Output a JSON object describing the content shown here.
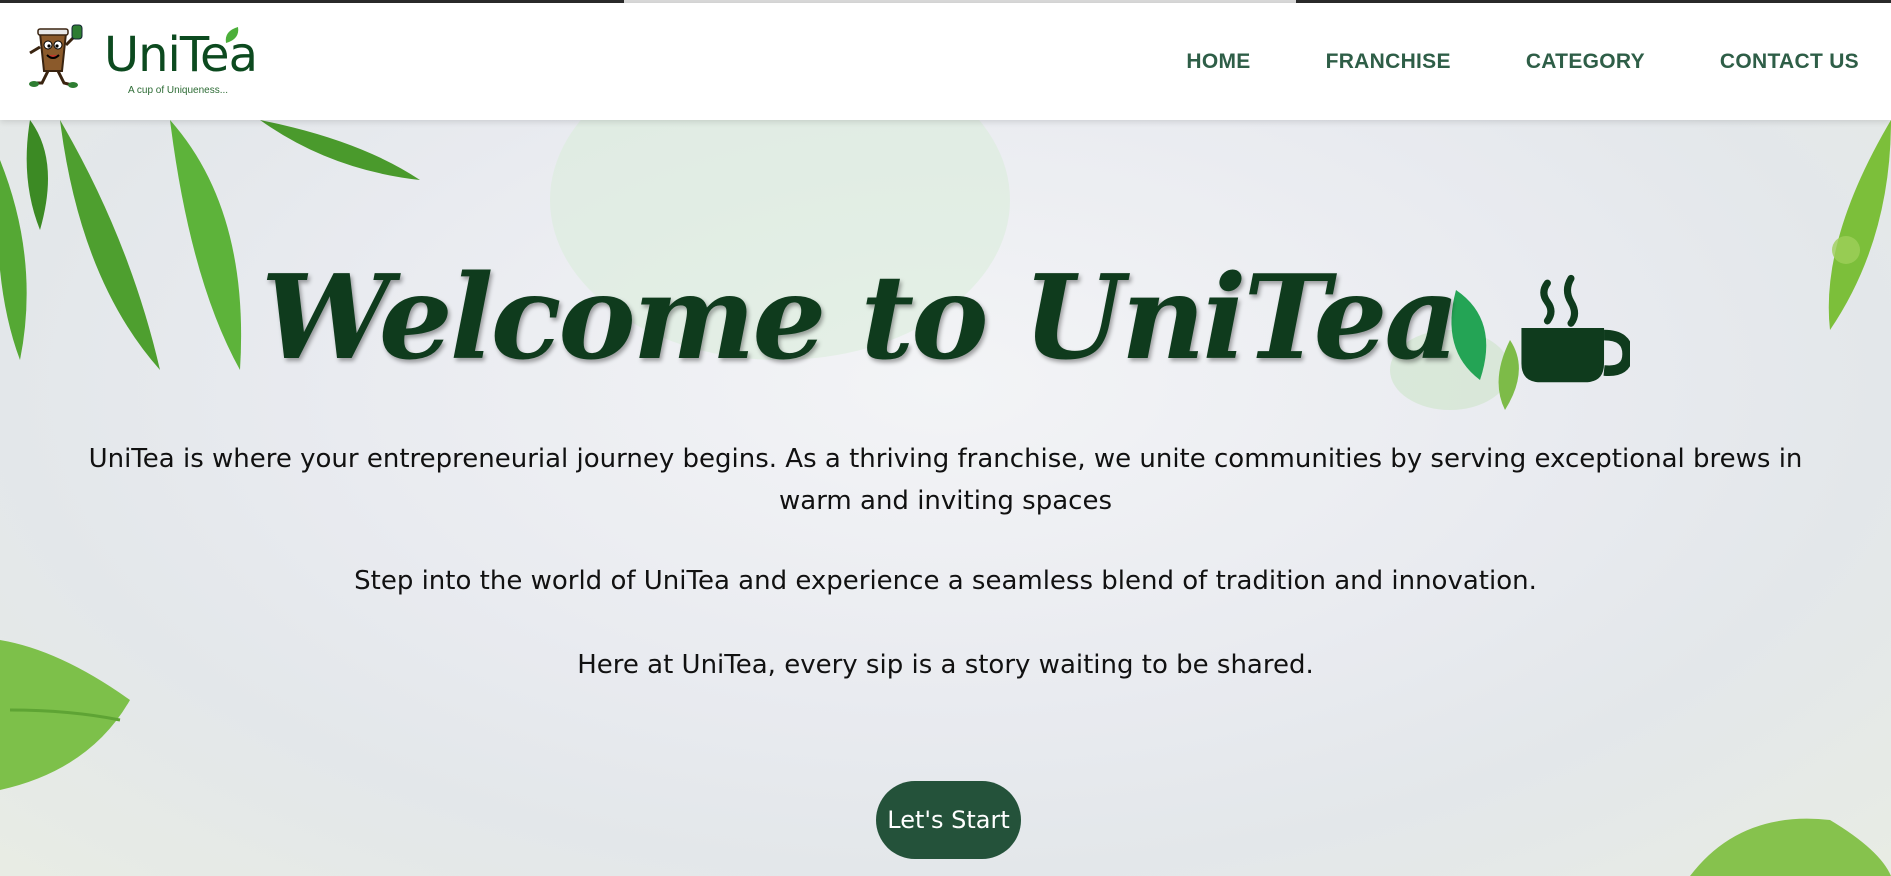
{
  "brand": {
    "name": "UniTea",
    "tagline": "A cup of Uniqueness..."
  },
  "nav": {
    "items": [
      {
        "label": "HOME"
      },
      {
        "label": "FRANCHISE"
      },
      {
        "label": "CATEGORY"
      },
      {
        "label": "CONTACT US"
      }
    ]
  },
  "hero": {
    "title": "Welcome to UniTea",
    "title_icon": "coffee-cup-icon",
    "paragraph1": "UniTea is where your entrepreneurial journey begins. As a thriving franchise, we unite communities by serving exceptional brews in warm and inviting spaces",
    "paragraph2": "Step into the world of UniTea and experience a seamless blend of tradition and innovation.",
    "paragraph3": "Here at UniTea, every sip is a story waiting to be shared.",
    "cta_label": "Let's Start"
  },
  "colors": {
    "nav_text": "#2e5e47",
    "title_text": "#0f3b1d",
    "button_bg": "#24523a",
    "leaf_green": "#4caf3a"
  }
}
